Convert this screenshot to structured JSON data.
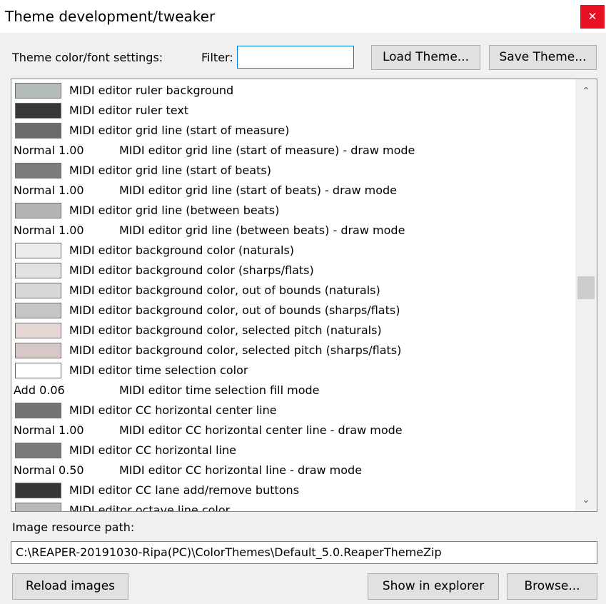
{
  "window": {
    "title": "Theme development/tweaker",
    "close_glyph": "✕"
  },
  "toolbar": {
    "settings_label": "Theme color/font settings:",
    "filter_label": "Filter:",
    "filter_value": "",
    "load_label": "Load Theme...",
    "save_label": "Save Theme..."
  },
  "list": {
    "scroll_position": 0.48,
    "rows": [
      {
        "type": "color",
        "swatch": "#b4bcbb",
        "label": "MIDI editor ruler background"
      },
      {
        "type": "color",
        "swatch": "#373737",
        "label": "MIDI editor ruler text"
      },
      {
        "type": "color",
        "swatch": "#6a6a6a",
        "label": "MIDI editor grid line (start of measure)"
      },
      {
        "type": "mode",
        "value": "Normal 1.00",
        "label": "MIDI editor grid line (start of measure) - draw mode"
      },
      {
        "type": "color",
        "swatch": "#7c7c7c",
        "label": "MIDI editor grid line (start of beats)"
      },
      {
        "type": "mode",
        "value": "Normal 1.00",
        "label": "MIDI editor grid line (start of beats) - draw mode"
      },
      {
        "type": "color",
        "swatch": "#b4b4b4",
        "label": "MIDI editor grid line (between beats)"
      },
      {
        "type": "mode",
        "value": "Normal 1.00",
        "label": "MIDI editor grid line (between beats) - draw mode"
      },
      {
        "type": "color",
        "swatch": "#ececec",
        "label": "MIDI editor background color (naturals)"
      },
      {
        "type": "color",
        "swatch": "#e2e2e2",
        "label": "MIDI editor background color (sharps/flats)"
      },
      {
        "type": "color",
        "swatch": "#d8d8d8",
        "label": "MIDI editor background color, out of bounds (naturals)"
      },
      {
        "type": "color",
        "swatch": "#c6c6c6",
        "label": "MIDI editor background color, out of bounds (sharps/flats)"
      },
      {
        "type": "color",
        "swatch": "#e7d6d6",
        "label": "MIDI editor background color, selected pitch (naturals)"
      },
      {
        "type": "color",
        "swatch": "#d8c7c7",
        "label": "MIDI editor background color, selected pitch (sharps/flats)"
      },
      {
        "type": "color",
        "swatch": "#ffffff",
        "label": "MIDI editor time selection color"
      },
      {
        "type": "mode",
        "value": "Add 0.06",
        "label": "MIDI editor time selection fill mode"
      },
      {
        "type": "color",
        "swatch": "#747474",
        "label": "MIDI editor CC horizontal center line"
      },
      {
        "type": "mode",
        "value": "Normal 1.00",
        "label": "MIDI editor CC horizontal center line - draw mode"
      },
      {
        "type": "color",
        "swatch": "#7a7a7a",
        "label": "MIDI editor CC horizontal line"
      },
      {
        "type": "mode",
        "value": "Normal 0.50",
        "label": "MIDI editor CC horizontal line - draw mode"
      },
      {
        "type": "color",
        "swatch": "#363636",
        "label": "MIDI editor CC lane add/remove buttons"
      },
      {
        "type": "color",
        "swatch": "#b9b9b9",
        "label": "MIDI editor octave line color"
      }
    ]
  },
  "resources": {
    "path_label": "Image resource path:",
    "path_value": "C:\\REAPER-20191030-Ripa(PC)\\ColorThemes\\Default_5.0.ReaperThemeZip"
  },
  "footer": {
    "reload_label": "Reload images",
    "show_label": "Show in explorer",
    "browse_label": "Browse..."
  },
  "icons": {
    "scroll_up": "chevron-up-icon",
    "scroll_down": "chevron-down-icon",
    "close": "close-icon"
  }
}
